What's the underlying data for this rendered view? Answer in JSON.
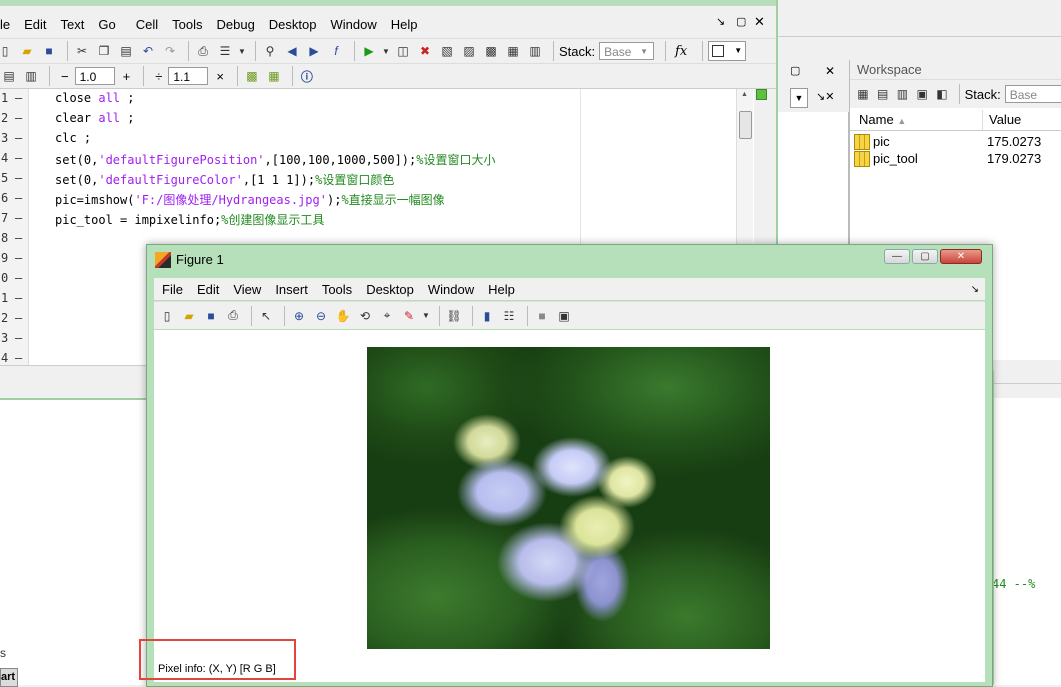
{
  "editor": {
    "menu": [
      "le",
      "Edit",
      "Text",
      "Go",
      "Cell",
      "Tools",
      "Debug",
      "Desktop",
      "Window",
      "Help"
    ],
    "stack_label": "Stack:",
    "stack_value": "Base",
    "cell_minus": "−",
    "cell_value1": "1.0",
    "cell_plus": "+",
    "cell_div": "÷",
    "cell_value2": "1.1",
    "cell_times": "×",
    "fx": "fx",
    "line_numbers": [
      "1",
      "2",
      "3",
      "4",
      "5",
      "6",
      "7",
      "8",
      "9",
      "0",
      "1",
      "2",
      "3",
      "4"
    ],
    "code_lines": [
      {
        "a": "close ",
        "b": "all",
        "c": " ;",
        "d": ""
      },
      {
        "a": "clear ",
        "b": "all",
        "c": " ;",
        "d": ""
      },
      {
        "a": "clc ;",
        "b": "",
        "c": "",
        "d": ""
      },
      {
        "a": "set(0,",
        "b": "'defaultFigurePosition'",
        "c": ",[100,100,1000,500]);",
        "d": "%设置窗口大小"
      },
      {
        "a": "set(0,",
        "b": "'defaultFigureColor'",
        "c": ",[1 1 1]);",
        "d": "%设置窗口颜色"
      },
      {
        "a": "pic=imshow(",
        "b": "'F:/图像处理/Hydrangeas.jpg'",
        "c": ");",
        "d": "%直接显示一幅图像"
      },
      {
        "a": "pic_tool = impixelinfo;",
        "b": "",
        "c": "",
        "d": "%创建图像显示工具"
      }
    ]
  },
  "workspace": {
    "title": "Workspace",
    "stack_label": "Stack:",
    "stack_value": "Base",
    "col_name": "Name",
    "col_value": "Value",
    "rows": [
      {
        "name": "pic",
        "value": "175.0273"
      },
      {
        "name": "pic_tool",
        "value": "179.0273"
      }
    ]
  },
  "background_text": {
    "command_snippet": "44 --%",
    "start_snippet": "art",
    "s_snippet": "s"
  },
  "figure": {
    "title": "Figure 1",
    "menu": [
      "File",
      "Edit",
      "View",
      "Insert",
      "Tools",
      "Desktop",
      "Window",
      "Help"
    ],
    "pixel_info_label": "Pixel info:",
    "pixel_info_value": "(X, Y)  [R G B]"
  },
  "colors": {
    "window_frame": "#b6e0b9",
    "highlight_box": "#e0463c",
    "comment": "#228b22",
    "string": "#a020f0"
  }
}
